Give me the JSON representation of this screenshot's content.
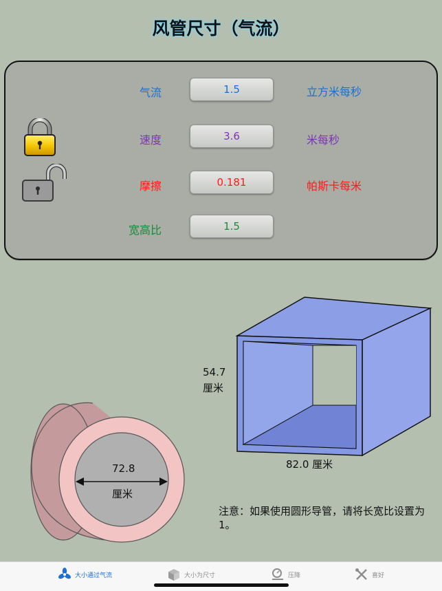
{
  "title": "风管尺寸（气流）",
  "rows": [
    {
      "label": "气流",
      "value": "1.5",
      "unit": "立方米每秒",
      "color": "#1b6fd2"
    },
    {
      "label": "速度",
      "value": "3.6",
      "unit": "米每秒",
      "color": "#7d35b3"
    },
    {
      "label": "摩擦",
      "value": "0.181",
      "unit": "帕斯卡每米",
      "color": "#ff1a1a"
    },
    {
      "label": "宽高比",
      "value": "1.5",
      "unit": "",
      "color": "#198a3a"
    }
  ],
  "locks": [
    {
      "icon": "lock-closed-icon",
      "state": "locked"
    },
    {
      "icon": "lock-open-icon",
      "state": "unlocked"
    }
  ],
  "rect_duct": {
    "height": "54.7",
    "height_unit": "厘米",
    "width_label": "82.0 厘米"
  },
  "round_duct": {
    "diameter": "72.8",
    "unit": "厘米"
  },
  "note": "注意：如果使用圆形导管，请将长宽比设置为1。",
  "tabs": [
    {
      "label": "大小通过气流",
      "icon": "fan-icon",
      "active": true
    },
    {
      "label": "大小为尺寸",
      "icon": "box-icon",
      "active": false
    },
    {
      "label": "压降",
      "icon": "pressure-gauge-icon",
      "active": false
    },
    {
      "label": "喜好",
      "icon": "tools-icon",
      "active": false
    }
  ],
  "colors": {
    "background": "#b4bfb0",
    "accent": "#1c6fd9",
    "duct": "#8c9ee6",
    "pipe": "#c79da0"
  }
}
